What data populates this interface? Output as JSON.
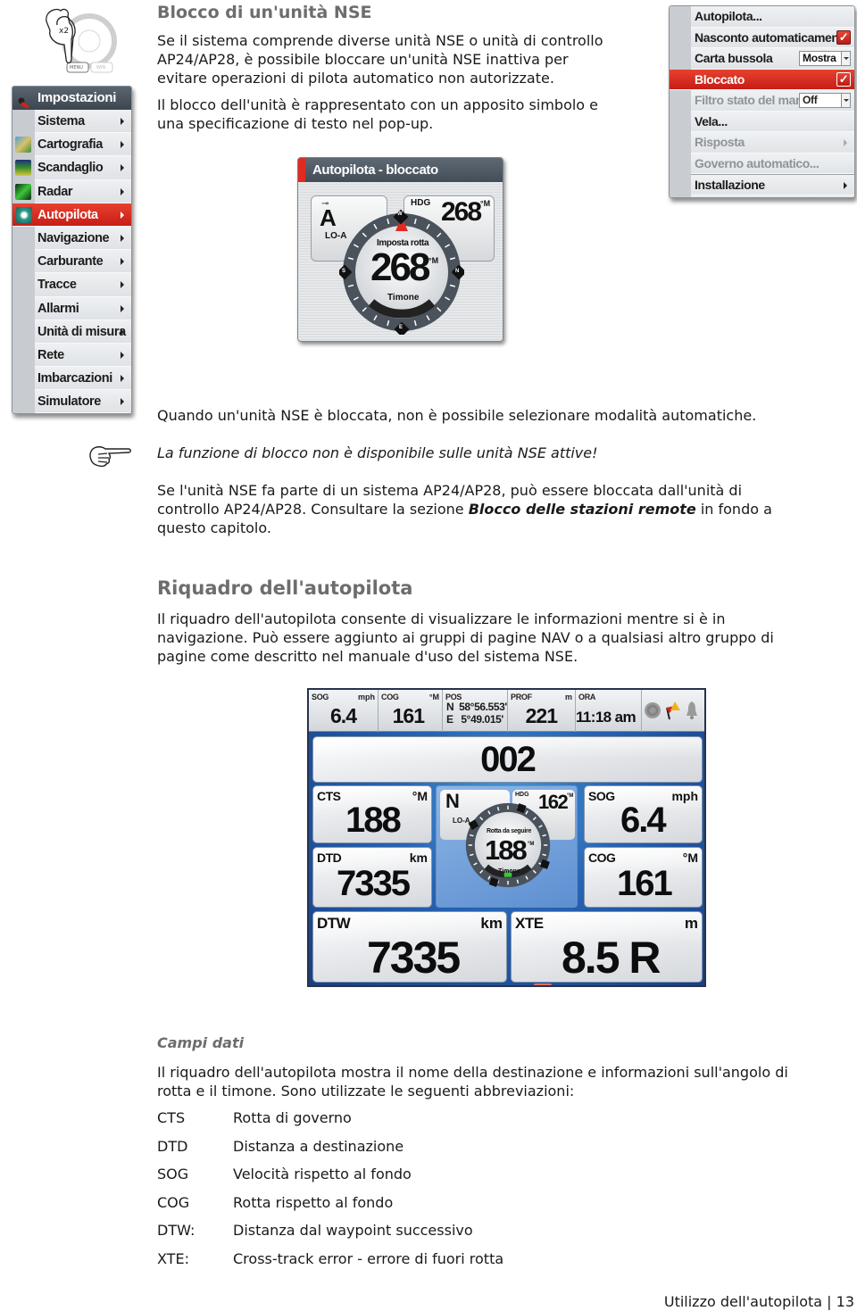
{
  "section1": {
    "title": "Blocco di un'unità NSE",
    "para1": [
      "Se il sistema comprende diverse unità NSE o unità di controllo",
      "AP24/AP28, è possibile bloccare un'unità NSE inattiva per",
      "evitare operazioni di pilota automatico non autorizzate."
    ],
    "para2": [
      "Il blocco dell'unità è rappresentato con un apposito simbolo e",
      "una specificazione di testo nel pop-up."
    ],
    "para3": "Quando un'unità NSE è bloccata, non è possibile selezionare modalità automatiche.",
    "note": "La funzione di blocco non è disponibile sulle unità NSE attive!",
    "para4": {
      "line1": "Se l'unità NSE fa parte di un sistema AP24/AP28, può essere bloccata dall'unità di",
      "line2_pre": "controllo AP24/AP28. Consultare la sezione ",
      "line2_bold": "Blocco delle stazioni remote",
      "line2_post": " in fondo a",
      "line3": "questo capitolo."
    }
  },
  "button_illustration": {
    "press_label": "x2",
    "menu_key": "MENU",
    "win_key": "WIN"
  },
  "settings_menu": {
    "title": "Impostazioni",
    "items": [
      {
        "label": "Sistema",
        "icon": "none"
      },
      {
        "label": "Cartografia",
        "icon": "chart-icon"
      },
      {
        "label": "Scandaglio",
        "icon": "sonar-icon"
      },
      {
        "label": "Radar",
        "icon": "radar-icon"
      },
      {
        "label": "Autopilota",
        "icon": "autopilot-icon",
        "selected": true
      },
      {
        "label": "Navigazione"
      },
      {
        "label": "Carburante"
      },
      {
        "label": "Tracce"
      },
      {
        "label": "Allarmi"
      },
      {
        "label": "Unità di misura"
      },
      {
        "label": "Rete"
      },
      {
        "label": "Imbarcazioni"
      },
      {
        "label": "Simulatore"
      }
    ]
  },
  "autopilot_menu": {
    "items": [
      {
        "label": "Autopilota..."
      },
      {
        "label": "Nasconto automaticamente",
        "checked": true
      },
      {
        "label": "Carta bussola",
        "dropdown": "Mostra"
      },
      {
        "label": "Bloccato",
        "checked": true,
        "selected": true
      },
      {
        "label": "Filtro stato del mare",
        "dropdown": "Off",
        "disabled": true
      },
      {
        "label": "Vela..."
      },
      {
        "label": "Risposta",
        "disabled": true
      },
      {
        "label": "Governo automatico...",
        "disabled": true
      },
      {
        "label": "Installazione"
      }
    ]
  },
  "locked_popup": {
    "title": "Autopilota - bloccato",
    "mode": "A",
    "mode_sub": "LO-A",
    "hdg_label": "HDG",
    "hdg_value": "268",
    "hdg_unit": "°M",
    "set_label": "Imposta rotta",
    "set_value": "268",
    "set_unit": "°M",
    "rudder_label": "Timone",
    "compass_marks": [
      "W",
      "S",
      "N",
      "E"
    ]
  },
  "section2": {
    "title": "Riquadro dell'autopilota",
    "para": [
      "Il riquadro dell'autopilota consente di visualizzare le informazioni mentre si è in",
      "navigazione. Può essere aggiunto ai gruppi di pagine NAV o a qualsiasi altro gruppo di",
      "pagine come descritto nel manuale d'uso del sistema NSE."
    ]
  },
  "panel": {
    "topbar": [
      {
        "label": "SOG",
        "unit": "mph",
        "value": "6.4"
      },
      {
        "label": "COG",
        "unit": "°M",
        "value": "161"
      },
      {
        "label": "POS",
        "unit": "",
        "value_lat": "N  58°56.553'",
        "value_lon": "E   5°49.015'"
      },
      {
        "label": "PROF",
        "unit": "m",
        "value": "221"
      },
      {
        "label": "ORA",
        "unit": "",
        "value": "11:18 am"
      }
    ],
    "destination": "002",
    "tiles": {
      "cts": {
        "label": "CTS",
        "unit": "°M",
        "value": "188"
      },
      "dtd": {
        "label": "DTD",
        "unit": "km",
        "value": "7335"
      },
      "sog": {
        "label": "SOG",
        "unit": "mph",
        "value": "6.4"
      },
      "cog": {
        "label": "COG",
        "unit": "°M",
        "value": "161"
      },
      "dtw": {
        "label": "DTW",
        "unit": "km",
        "value": "7335"
      },
      "xte": {
        "label": "XTE",
        "unit": "m",
        "value": "8.5 R"
      }
    },
    "compass": {
      "mode": "N",
      "mode_sub": "LO-A",
      "hdg_label": "HDG",
      "hdg_value": "162",
      "hdg_unit": "°M",
      "ctf_label": "Rotta da seguire",
      "ctf_value": "188",
      "ctf_unit": "°M",
      "rudder_label": "Timone"
    }
  },
  "section3": {
    "title": "Campi dati",
    "para": [
      "Il riquadro dell'autopilota mostra il nome della destinazione e informazioni sull'angolo di",
      "rotta e il timone. Sono utilizzate le seguenti abbreviazioni:"
    ],
    "abbreviations": [
      {
        "abbr": "CTS",
        "desc": "Rotta di governo"
      },
      {
        "abbr": "DTD",
        "desc": "Distanza a destinazione"
      },
      {
        "abbr": "SOG",
        "desc": "Velocità rispetto al fondo"
      },
      {
        "abbr": "COG",
        "desc": "Rotta rispetto al fondo"
      },
      {
        "abbr": "DTW:",
        "desc": "Distanza dal waypoint successivo"
      },
      {
        "abbr": "XTE:",
        "desc": "Cross-track error - errore di fuori rotta"
      }
    ]
  },
  "footer": {
    "chapter": "Utilizzo dell'autopilota",
    "separator": "|",
    "page": "13"
  }
}
